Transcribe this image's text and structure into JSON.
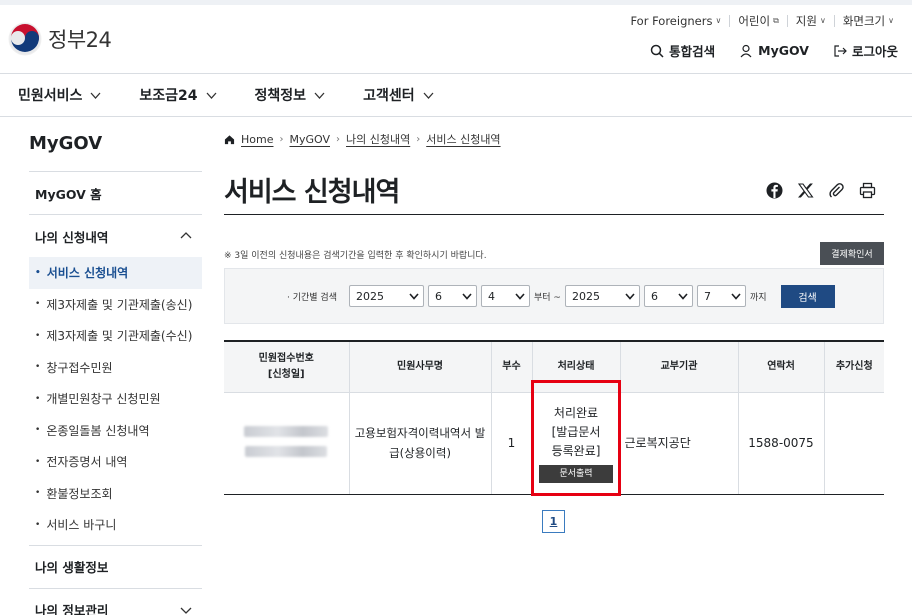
{
  "header": {
    "logo_text": "정부24",
    "utils": [
      "For Foreigners",
      "어린이",
      "지원",
      "화면크기"
    ],
    "actions": [
      "통합검색",
      "MyGOV",
      "로그아웃"
    ]
  },
  "gnb": [
    "민원서비스",
    "보조금24",
    "정책정보",
    "고객센터"
  ],
  "sidebar": {
    "title": "MyGOV",
    "home": "MyGOV 홈",
    "group1": "나의 신청내역",
    "items": [
      "서비스 신청내역",
      "제3자제출 및 기관제출(송신)",
      "제3자제출 및 기관제출(수신)",
      "창구접수민원",
      "개별민원창구 신청민원",
      "온종일돌봄 신청내역",
      "전자증명서 내역",
      "환불정보조회",
      "서비스 바구니"
    ],
    "group2": "나의 생활정보",
    "group3": "나의 정보관리"
  },
  "breadcrumb": [
    "Home",
    "MyGOV",
    "나의 신청내역",
    "서비스 신청내역"
  ],
  "page_title": "서비스 신청내역",
  "notice": "※ 3일 이전의 신청내용은 검색기간을 입력한 후 확인하시기 바랍니다.",
  "confirm_button": "결제확인서",
  "filter": {
    "label": "· 기간별 검색",
    "from_year": "2025",
    "from_month": "6",
    "from_day": "4",
    "from_suffix": "부터 ~",
    "to_year": "2025",
    "to_month": "6",
    "to_day": "7",
    "to_suffix": "까지",
    "search": "검색"
  },
  "table": {
    "headers": [
      "민원접수번호\n[신청일]",
      "민원사무명",
      "부수",
      "처리상태",
      "교부기관",
      "연락처",
      "추가신청"
    ],
    "row": {
      "name_line1": "고용보험자격이력내역서 발",
      "name_line2": "급(상용이력)",
      "count": "1",
      "status_line1": "처리완료",
      "status_line2": "[발급문서",
      "status_line3": "등록완료]",
      "print_button": "문서출력",
      "agency": "근로복지공단",
      "phone": "1588-0075",
      "extra": ""
    }
  },
  "pagination": {
    "current": "1"
  },
  "colors": {
    "highlight": "#e60012",
    "primary": "#1f4a83"
  }
}
